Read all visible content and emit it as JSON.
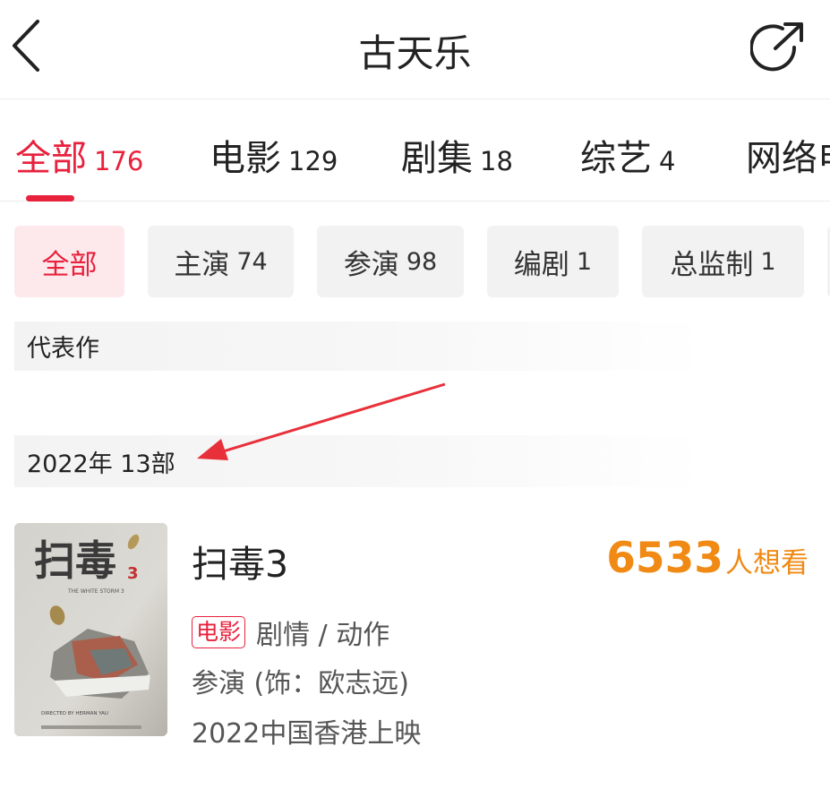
{
  "header": {
    "title": "古天乐"
  },
  "tabs": [
    {
      "label": "全部",
      "count": "176",
      "active": true
    },
    {
      "label": "电影",
      "count": "129"
    },
    {
      "label": "剧集",
      "count": "18"
    },
    {
      "label": "综艺",
      "count": "4"
    },
    {
      "label": "网络电",
      "count": ""
    }
  ],
  "filters": [
    {
      "label": "全部",
      "count": "",
      "active": true
    },
    {
      "label": "主演",
      "count": "74"
    },
    {
      "label": "参演",
      "count": "98"
    },
    {
      "label": "编剧",
      "count": "1"
    },
    {
      "label": "总监制",
      "count": "1"
    }
  ],
  "sections": {
    "representative": "代表作",
    "year_group": "2022年 13部"
  },
  "movie": {
    "title": "扫毒3",
    "want_count": "6533",
    "want_label": "人想看",
    "type_badge": "电影",
    "genre": "剧情 / 动作",
    "role": "参演 (饰：欧志远)",
    "release": "2022中国香港上映",
    "poster": {
      "title_cn": "扫毒",
      "number": "3",
      "title_en": "THE WHITE STORM 3",
      "credit": "DIRECTED BY HERMAN YAU"
    }
  },
  "colors": {
    "accent": "#e8213d",
    "want": "#f08a14",
    "annotation_arrow": "#e8303a"
  }
}
